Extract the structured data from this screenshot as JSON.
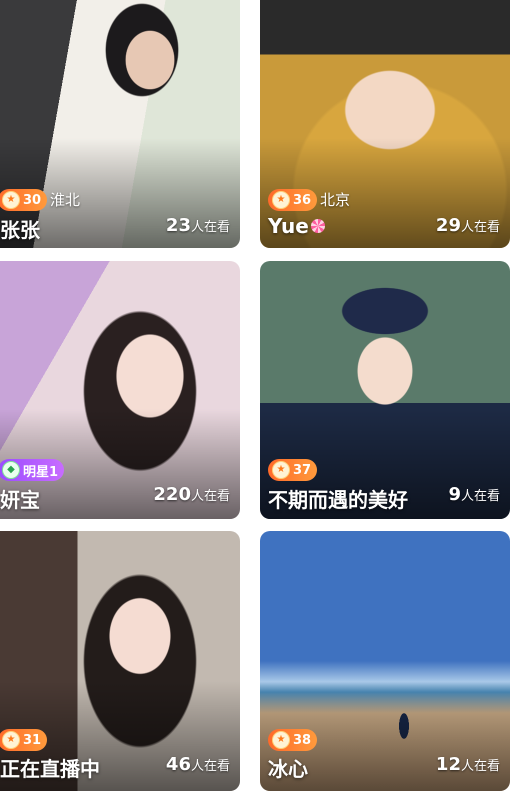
{
  "streams": [
    {
      "name": "张张",
      "location": "淮北",
      "level": "30",
      "viewers": "23",
      "viewers_suffix": "人在看"
    },
    {
      "name": "Yue",
      "location": "北京",
      "level": "36",
      "viewers": "29",
      "viewers_suffix": "人在看"
    },
    {
      "name": "妍宝",
      "location": "",
      "level": "明星1",
      "viewers": "220",
      "viewers_suffix": "人在看"
    },
    {
      "name": "不期而遇的美好",
      "location": "",
      "level": "37",
      "viewers": "9",
      "viewers_suffix": "人在看"
    },
    {
      "name": "正在直播中",
      "location": "",
      "level": "31",
      "viewers": "46",
      "viewers_suffix": "人在看"
    },
    {
      "name": "冰心",
      "location": "",
      "level": "38",
      "viewers": "12",
      "viewers_suffix": "人在看"
    }
  ],
  "colors": {
    "level_badge": "#ff6a2a",
    "star_badge": "#9a4cff"
  }
}
